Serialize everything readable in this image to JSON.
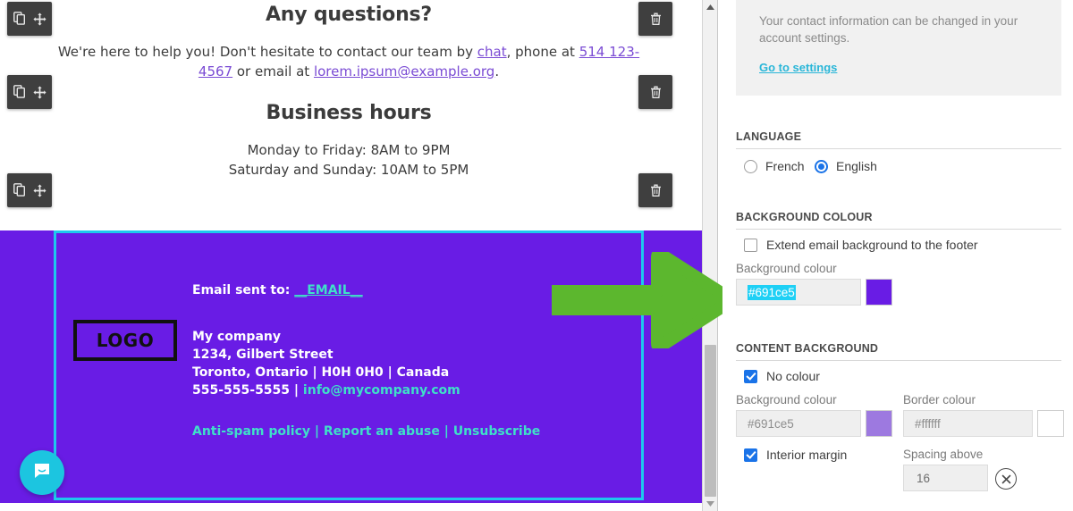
{
  "preview": {
    "blocks": [
      {
        "heading": "Any questions?",
        "paragraph_1": "We're here to help you! Don't hesitate to contact our team by ",
        "link_chat": "chat",
        "paragraph_2": ", phone at ",
        "link_phone": "514 123-4567",
        "paragraph_3": " or email at ",
        "link_email": "lorem.ipsum@example.org",
        "paragraph_4": "."
      },
      {
        "heading": "Business hours",
        "line_1": "Monday to Friday: 8AM to 9PM",
        "line_2": "Saturday and Sunday: 10AM to 5PM"
      }
    ],
    "toolbar": {
      "duplicate_icon": "duplicate-icon",
      "move_icon": "move-icon",
      "delete_icon": "trash-icon"
    },
    "footer": {
      "email_sent_label": "Email sent to: ",
      "email_token": "__EMAIL__",
      "logo_text": "LOGO",
      "company": "My company",
      "street": "1234, Gilbert Street",
      "city_line": "Toronto, Ontario | H0H 0H0 | Canada",
      "phone": "555-555-5555",
      "separator": " | ",
      "email": "info@mycompany.com",
      "link_antispam": "Anti-spam policy",
      "link_report": "Report an abuse",
      "link_unsubscribe": "Unsubscribe",
      "background_colour": "#691ce5",
      "selection_colour": "#1ec8ed",
      "accent_text_colour": "#3fe0c8"
    },
    "chat_widget_icon": "chat-bubble-icon",
    "scrollbar": {
      "up_arrow": "scroll-up-icon",
      "down_arrow": "scroll-down-icon"
    }
  },
  "annotation": {
    "arrow_icon": "green-arrow-right",
    "arrow_colour": "#5cb72e"
  },
  "panel": {
    "note": {
      "text": "Your contact information can be changed in your account settings.",
      "link": "Go to settings",
      "link_colour": "#29b6d8"
    },
    "language": {
      "section_title": "LANGUAGE",
      "options": [
        {
          "label": "French",
          "selected": false
        },
        {
          "label": "English",
          "selected": true
        }
      ]
    },
    "background_colour": {
      "section_title": "BACKGROUND COLOUR",
      "extend_label": "Extend email background to the footer",
      "extend_checked": false,
      "field_label": "Background colour",
      "value": "#691ce5",
      "swatch_colour": "#691ce5"
    },
    "content_background": {
      "section_title": "CONTENT BACKGROUND",
      "no_colour_label": "No colour",
      "no_colour_checked": true,
      "background_label": "Background colour",
      "background_value": "#691ce5",
      "background_swatch": "#9d79e0",
      "border_label": "Border colour",
      "border_value": "#ffffff",
      "border_swatch": "#ffffff",
      "interior_margin_label": "Interior margin",
      "interior_margin_checked": true,
      "spacing_label": "Spacing above",
      "spacing_value": "16",
      "clear_icon": "clear-circle-icon"
    }
  }
}
